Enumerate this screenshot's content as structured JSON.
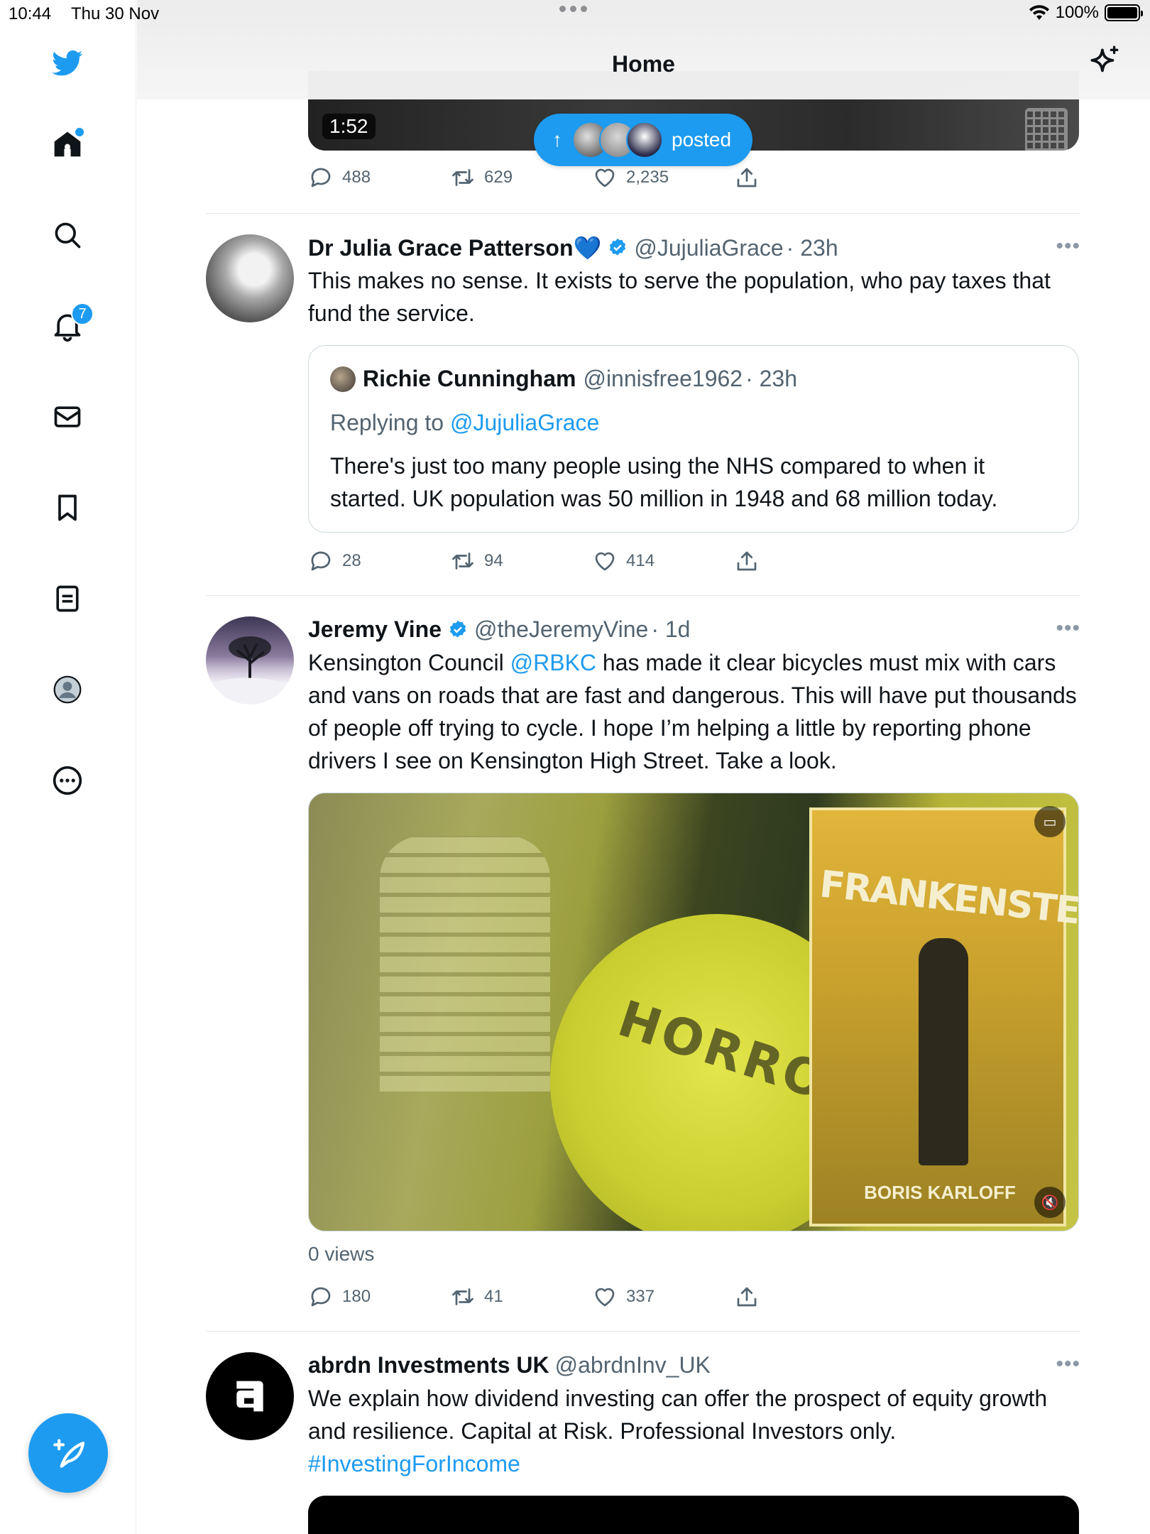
{
  "status_bar": {
    "time": "10:44",
    "date": "Thu 30 Nov",
    "battery": "100%"
  },
  "header": {
    "title": "Home"
  },
  "sidebar": {
    "items": [
      {
        "name": "home",
        "label": "Home"
      },
      {
        "name": "explore",
        "label": "Explore"
      },
      {
        "name": "notifications",
        "label": "Notifications",
        "badge": "7"
      },
      {
        "name": "messages",
        "label": "Messages"
      },
      {
        "name": "bookmarks",
        "label": "Bookmarks"
      },
      {
        "name": "lists",
        "label": "Lists"
      },
      {
        "name": "profile",
        "label": "Profile"
      },
      {
        "name": "more",
        "label": "More"
      }
    ]
  },
  "top_post": {
    "duration": "1:52",
    "replies": "488",
    "retweets": "629",
    "likes": "2,235"
  },
  "posted_pill": {
    "label": "posted"
  },
  "tweets": [
    {
      "name": "Dr Julia Grace Patterson💙",
      "handle": "@JujuliaGrace",
      "time": "· 23h",
      "text": "This makes no sense. It exists to serve the population, who pay taxes that fund the service.",
      "quote": {
        "name": "Richie Cunningham",
        "handle": "@innisfree1962",
        "time": "· 23h",
        "replying_prefix": "Replying to ",
        "replying_handle": "@JujuliaGrace",
        "text": "There's just too many people using the NHS compared to when it started. UK population was 50 million in 1948 and 68 million today."
      },
      "replies": "28",
      "retweets": "94",
      "likes": "414"
    },
    {
      "name": "Jeremy Vine",
      "handle": "@theJeremyVine",
      "time": "· 1d",
      "text_before": "Kensington Council ",
      "mention": "@RBKC",
      "text_after": " has made it clear bicycles must mix with cars and vans on roads that are fast and dangerous. This will have put thousands of people off trying to cycle. I hope I’m helping a little by reporting phone drivers I see on Kensington High Street. Take a look.",
      "video": {
        "sign_text": "HORROR",
        "poster_title": "FRANKENSTEIN",
        "poster_credit": "BORIS KARLOFF"
      },
      "views": "0 views",
      "replies": "180",
      "retweets": "41",
      "likes": "337"
    },
    {
      "name": "abrdn Investments UK",
      "handle": "@abrdnInv_UK",
      "text": "We explain how dividend investing can offer the prospect of equity growth and resilience. Capital at Risk. Professional Investors only.",
      "hashtag": "#InvestingForIncome"
    }
  ],
  "colors": {
    "accent": "#1d9bf0",
    "text": "#0f1419",
    "muted": "#536471"
  }
}
